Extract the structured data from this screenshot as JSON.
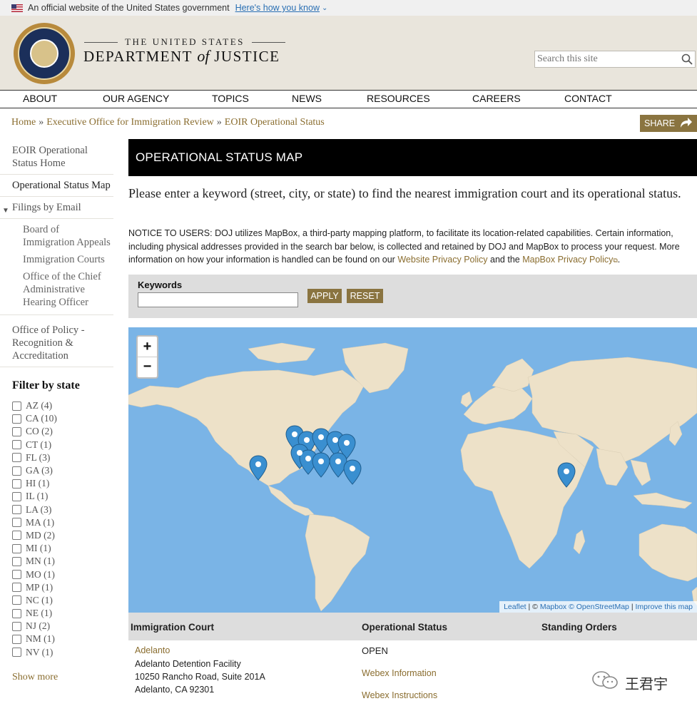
{
  "gov_banner": {
    "text": "An official website of the United States government",
    "link": "Here's how you know"
  },
  "agency": {
    "line1": "THE UNITED STATES",
    "line2_a": "DEPARTMENT",
    "line2_of": "of",
    "line2_b": "JUSTICE"
  },
  "search": {
    "placeholder": "Search this site"
  },
  "nav": {
    "items": [
      "ABOUT",
      "OUR AGENCY",
      "TOPICS",
      "NEWS",
      "RESOURCES",
      "CAREERS",
      "CONTACT"
    ]
  },
  "breadcrumb": {
    "items": [
      "Home",
      "Executive Office for Immigration Review",
      "EOIR Operational Status"
    ],
    "separator": "»"
  },
  "share_label": "SHARE",
  "sidebar": {
    "items": [
      "EOIR Operational Status Home",
      "Operational Status Map",
      "Filings by Email"
    ],
    "sub_items": [
      "Board of Immigration Appeals",
      "Immigration Courts",
      "Office of the Chief Administrative Hearing Officer"
    ],
    "after_item": "Office of Policy - Recognition & Accreditation",
    "filter_title": "Filter by state",
    "states": [
      "AZ (4)",
      "CA (10)",
      "CO (2)",
      "CT (1)",
      "FL (3)",
      "GA (3)",
      "HI (1)",
      "IL (1)",
      "LA (3)",
      "MA (1)",
      "MD (2)",
      "MI (1)",
      "MN (1)",
      "MO (1)",
      "MP (1)",
      "NC (1)",
      "NE (1)",
      "NJ (2)",
      "NM (1)",
      "NV (1)"
    ],
    "show_more": "Show more"
  },
  "main": {
    "title": "OPERATIONAL STATUS MAP",
    "prompt": "Please enter a keyword (street, city, or state) to find the nearest immigration court and its operational status.",
    "notice_text": "NOTICE TO USERS: DOJ utilizes MapBox, a third-party mapping platform, to facilitate its location-related capabilities. Certain information, including physical addresses provided in the search bar below, is collected and retained by DOJ and MapBox to process your request. More information on how your information is handled can be found on our",
    "notice_link1": "Website Privacy Policy",
    "notice_mid": "and the",
    "notice_link2": "MapBox Privacy Policy",
    "notice_end": ".",
    "keywords_label": "Keywords",
    "apply_label": "APPLY",
    "reset_label": "RESET"
  },
  "map": {
    "zoom_in": "+",
    "zoom_out": "−",
    "attribution": {
      "leaflet": "Leaflet",
      "sep1": "| ©",
      "mapbox": "Mapbox",
      "osm": "© OpenStreetMap",
      "sep2": "|",
      "improve": "Improve this map"
    },
    "marker_color": "#3a8fd0",
    "land_color": "#ede1c8",
    "water_color": "#7ab4e6"
  },
  "table": {
    "headers": [
      "Immigration Court",
      "Operational Status",
      "Standing Orders"
    ],
    "row": {
      "name": "Adelanto",
      "address_lines": [
        "Adelanto Detention Facility",
        "10250 Rancho Road, Suite 201A",
        "Adelanto, CA 92301"
      ],
      "status": "OPEN",
      "webex_info": "Webex Information",
      "webex_instructions": "Webex Instructions"
    }
  },
  "watermark": "王君宇"
}
